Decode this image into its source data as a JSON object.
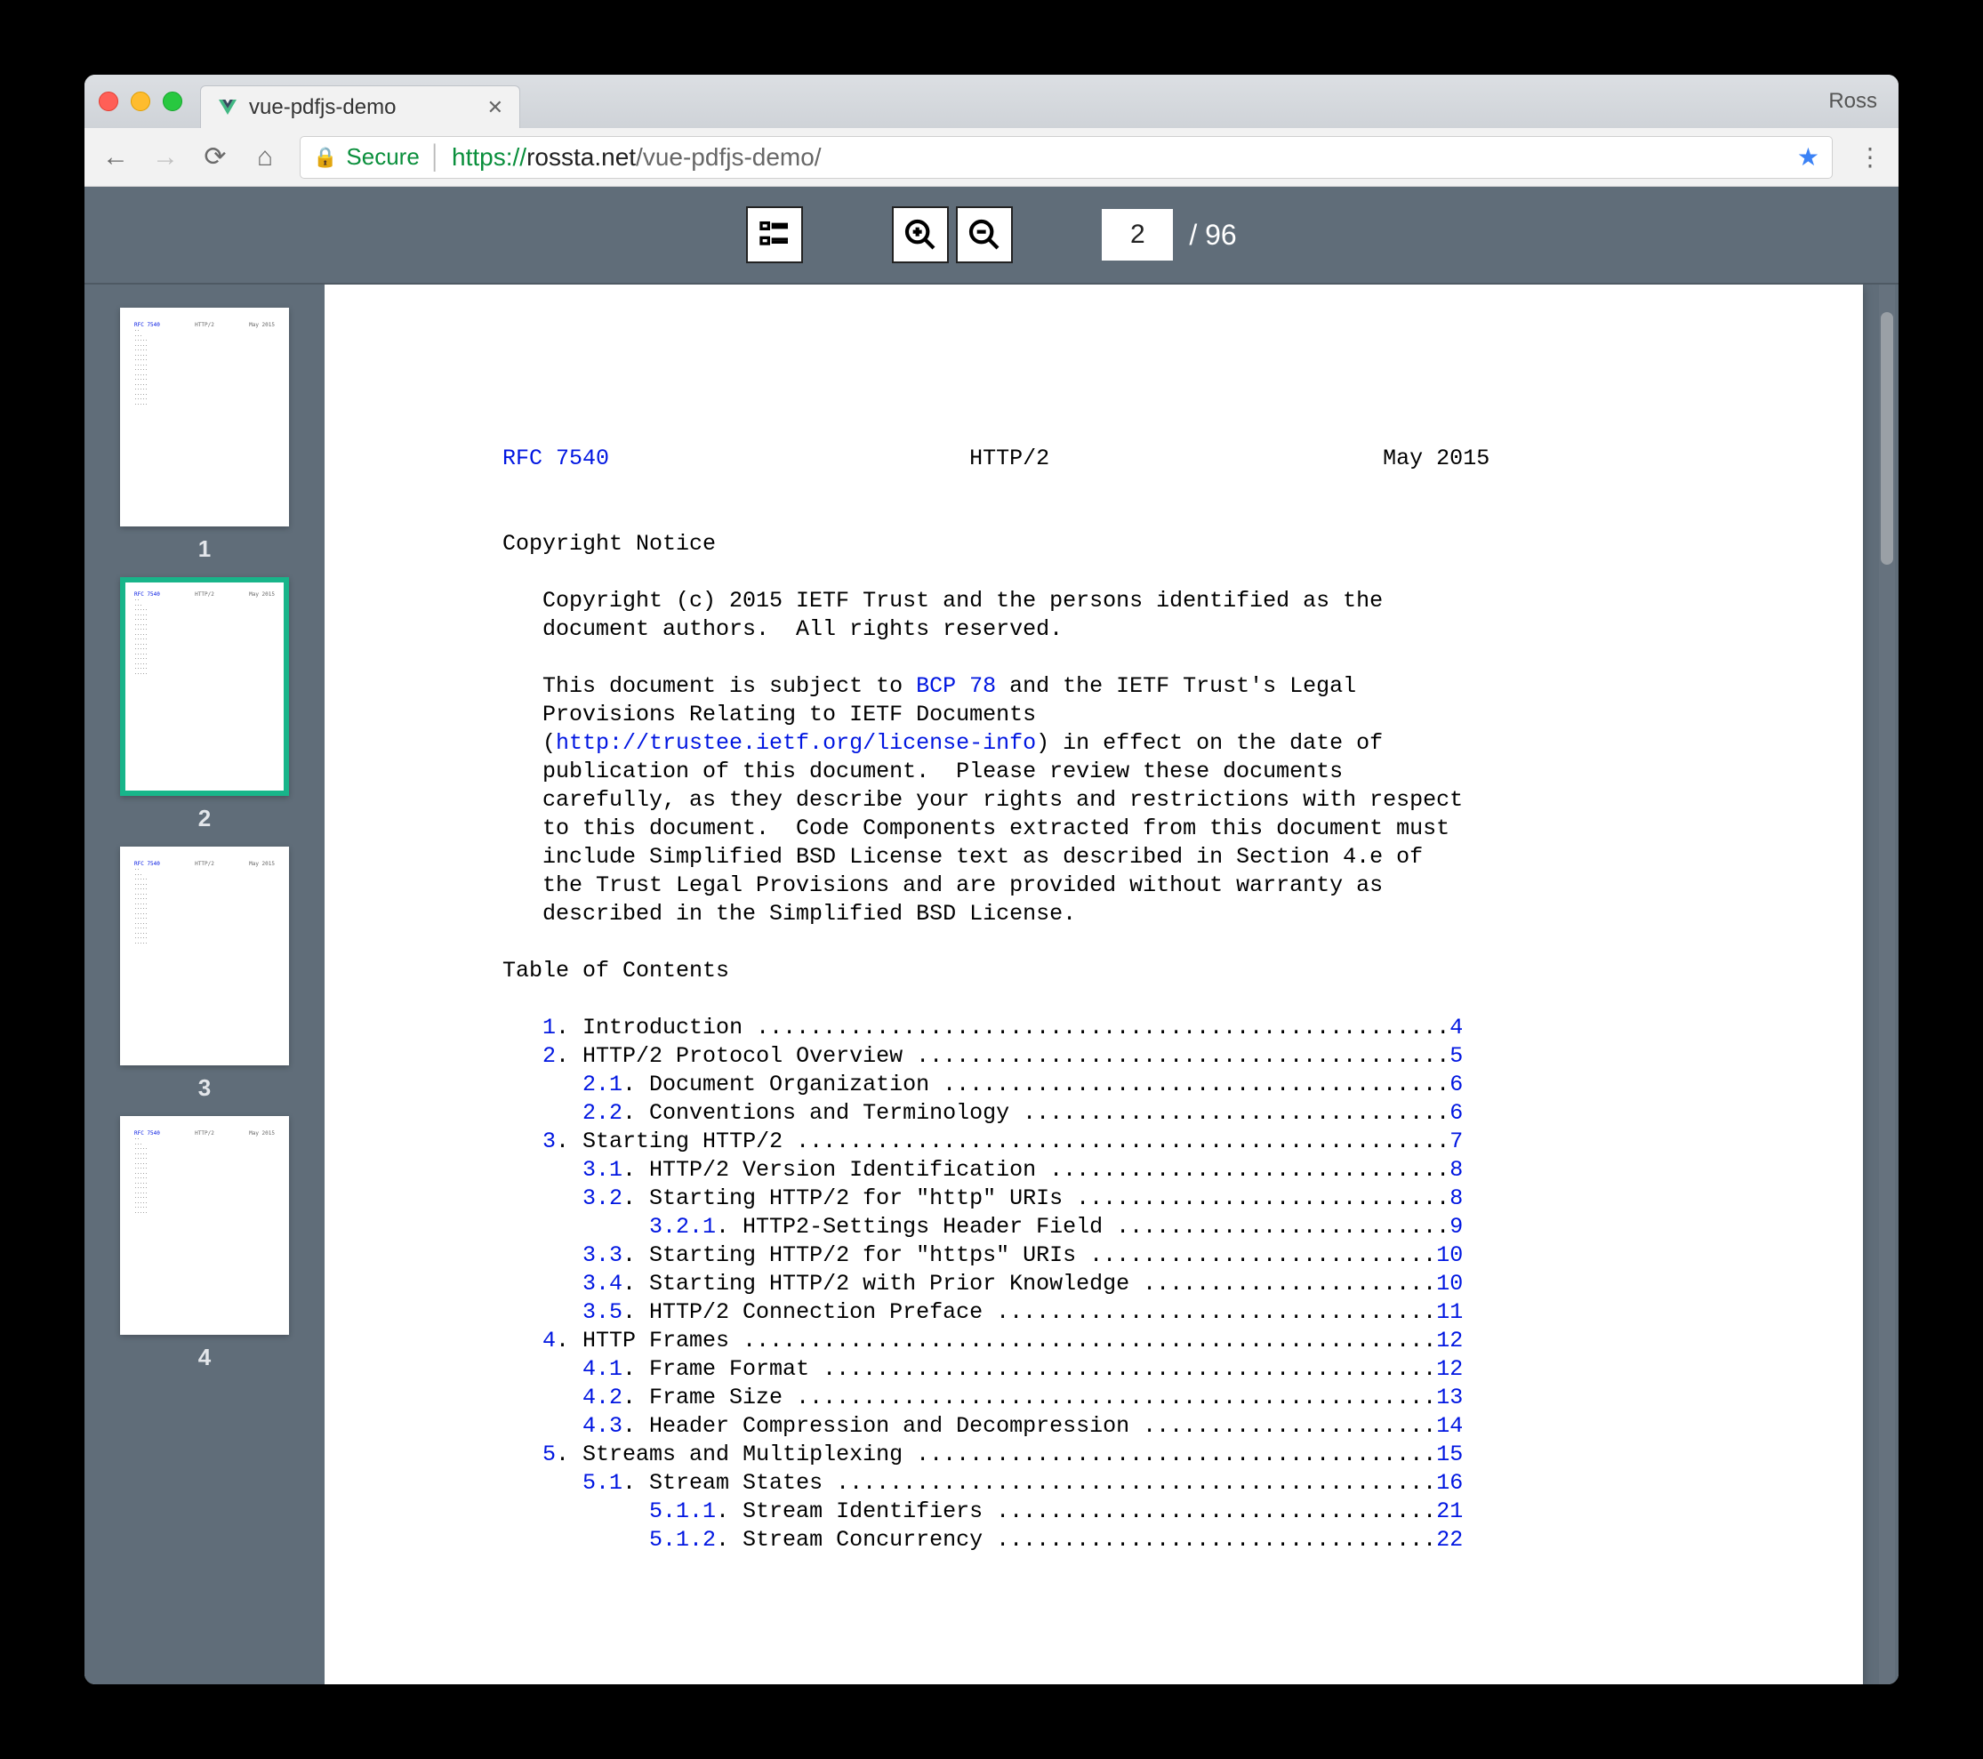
{
  "browser": {
    "profile_name": "Ross",
    "tab_title": "vue-pdfjs-demo",
    "secure_label": "Secure",
    "url_protocol": "https://",
    "url_host": "rossta.net",
    "url_path": "/vue-pdfjs-demo/"
  },
  "toolbar": {
    "current_page": "2",
    "total_pages_label": "/ 96"
  },
  "thumbnails": {
    "items": [
      {
        "num": "1",
        "active": false
      },
      {
        "num": "2",
        "active": true
      },
      {
        "num": "3",
        "active": false
      },
      {
        "num": "4",
        "active": false
      }
    ]
  },
  "document": {
    "header": {
      "rfc_link": "RFC 7540",
      "title": "HTTP/2",
      "date": "May 2015"
    },
    "copyright_heading": "Copyright Notice",
    "copyright_p1": "   Copyright (c) 2015 IETF Trust and the persons identified as the\n   document authors.  All rights reserved.",
    "copyright_p2a": "   This document is subject to ",
    "bcp_link": "BCP 78",
    "copyright_p2b": " and the IETF Trust's Legal\n   Provisions Relating to IETF Documents\n   (",
    "license_link": "http://trustee.ietf.org/license-info",
    "copyright_p2c": ") in effect on the date of\n   publication of this document.  Please review these documents\n   carefully, as they describe your rights and restrictions with respect\n   to this document.  Code Components extracted from this document must\n   include Simplified BSD License text as described in Section 4.e of\n   the Trust Legal Provisions and are provided without warranty as\n   described in the Simplified BSD License.",
    "toc_heading": "Table of Contents",
    "toc": [
      {
        "indent": "   ",
        "num": "1",
        "title": ". Introduction ....................................................",
        "page": "4"
      },
      {
        "indent": "   ",
        "num": "2",
        "title": ". HTTP/2 Protocol Overview ........................................",
        "page": "5"
      },
      {
        "indent": "      ",
        "num": "2.1",
        "title": ". Document Organization ......................................",
        "page": "6"
      },
      {
        "indent": "      ",
        "num": "2.2",
        "title": ". Conventions and Terminology ................................",
        "page": "6"
      },
      {
        "indent": "   ",
        "num": "3",
        "title": ". Starting HTTP/2 .................................................",
        "page": "7"
      },
      {
        "indent": "      ",
        "num": "3.1",
        "title": ". HTTP/2 Version Identification ..............................",
        "page": "8"
      },
      {
        "indent": "      ",
        "num": "3.2",
        "title": ". Starting HTTP/2 for \"http\" URIs ............................",
        "page": "8"
      },
      {
        "indent": "           ",
        "num": "3.2.1",
        "title": ". HTTP2-Settings Header Field .........................",
        "page": "9"
      },
      {
        "indent": "      ",
        "num": "3.3",
        "title": ". Starting HTTP/2 for \"https\" URIs ..........................",
        "page": "10"
      },
      {
        "indent": "      ",
        "num": "3.4",
        "title": ". Starting HTTP/2 with Prior Knowledge ......................",
        "page": "10"
      },
      {
        "indent": "      ",
        "num": "3.5",
        "title": ". HTTP/2 Connection Preface .................................",
        "page": "11"
      },
      {
        "indent": "   ",
        "num": "4",
        "title": ". HTTP Frames ....................................................",
        "page": "12"
      },
      {
        "indent": "      ",
        "num": "4.1",
        "title": ". Frame Format ..............................................",
        "page": "12"
      },
      {
        "indent": "      ",
        "num": "4.2",
        "title": ". Frame Size ................................................",
        "page": "13"
      },
      {
        "indent": "      ",
        "num": "4.3",
        "title": ". Header Compression and Decompression ......................",
        "page": "14"
      },
      {
        "indent": "   ",
        "num": "5",
        "title": ". Streams and Multiplexing .......................................",
        "page": "15"
      },
      {
        "indent": "      ",
        "num": "5.1",
        "title": ". Stream States .............................................",
        "page": "16"
      },
      {
        "indent": "           ",
        "num": "5.1.1",
        "title": ". Stream Identifiers .................................",
        "page": "21"
      },
      {
        "indent": "           ",
        "num": "5.1.2",
        "title": ". Stream Concurrency .................................",
        "page": "22"
      }
    ]
  }
}
